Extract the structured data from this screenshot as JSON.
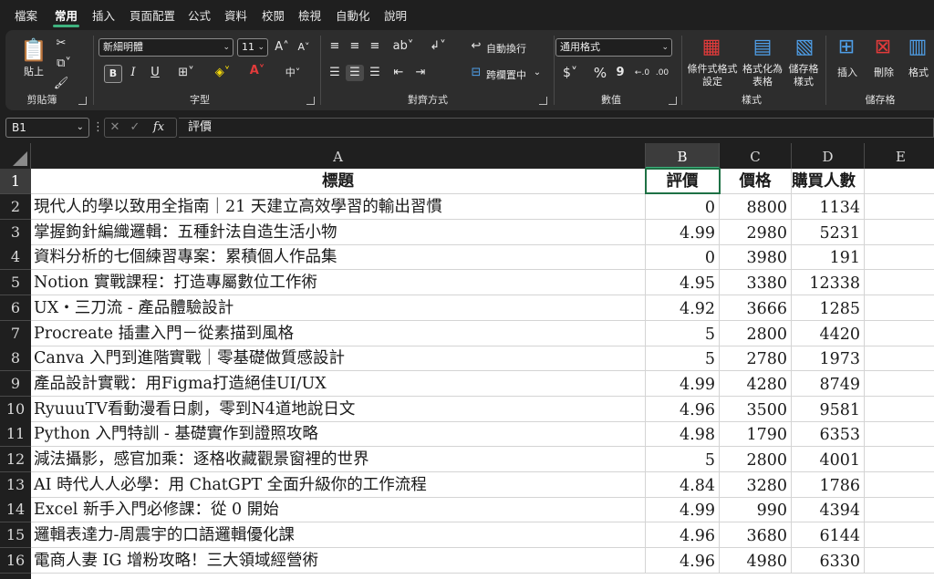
{
  "tabs": [
    "檔案",
    "常用",
    "插入",
    "頁面配置",
    "公式",
    "資料",
    "校閱",
    "檢視",
    "自動化",
    "說明"
  ],
  "ribbon": {
    "clipboard": {
      "paste": "貼上",
      "label": "剪貼簿"
    },
    "font": {
      "name": "新細明體",
      "size": "11",
      "label": "字型",
      "bold": "B",
      "italic": "I",
      "underline": "U"
    },
    "alignment": {
      "wrap": "自動換行",
      "merge": "跨欄置中",
      "label": "對齊方式"
    },
    "number": {
      "format": "通用格式",
      "currency": "$",
      "percent": "%",
      "comma": "9",
      "label": "數值"
    },
    "styles": {
      "conditional": "條件式格式\n設定",
      "table": "格式化為\n表格",
      "cell": "儲存格\n樣式",
      "label": "樣式"
    },
    "cells": {
      "insert": "插入",
      "delete": "刪除",
      "format": "格式",
      "label": "儲存格"
    }
  },
  "formula_bar": {
    "name_box": "B1",
    "fx": "fx",
    "content": "評價"
  },
  "columns": [
    "A",
    "B",
    "C",
    "D",
    "E"
  ],
  "headers": {
    "title": "標題",
    "rating": "評價",
    "price": "價格",
    "buyers": "購買人數"
  },
  "rows": [
    {
      "n": "2",
      "title": "現代人的學以致用全指南｜21 天建立高效學習的輸出習慣",
      "rating": "0",
      "price": "8800",
      "buyers": "1134"
    },
    {
      "n": "3",
      "title": "掌握鉤針編織邏輯：五種針法自造生活小物",
      "rating": "4.99",
      "price": "2980",
      "buyers": "5231"
    },
    {
      "n": "4",
      "title": "資料分析的七個練習專案：累積個人作品集",
      "rating": "0",
      "price": "3980",
      "buyers": "191"
    },
    {
      "n": "5",
      "title": "Notion 實戰課程：打造專屬數位工作術",
      "rating": "4.95",
      "price": "3380",
      "buyers": "12338"
    },
    {
      "n": "6",
      "title": "UX・三刀流 - 產品體驗設計",
      "rating": "4.92",
      "price": "3666",
      "buyers": "1285"
    },
    {
      "n": "7",
      "title": "Procreate 插畫入門－從素描到風格",
      "rating": "5",
      "price": "2800",
      "buyers": "4420"
    },
    {
      "n": "8",
      "title": "Canva 入門到進階實戰｜零基礎做質感設計",
      "rating": "5",
      "price": "2780",
      "buyers": "1973"
    },
    {
      "n": "9",
      "title": "產品設計實戰：用Figma打造絕佳UI/UX",
      "rating": "4.99",
      "price": "4280",
      "buyers": "8749"
    },
    {
      "n": "10",
      "title": "RyuuuTV看動漫看日劇，零到N4道地說日文",
      "rating": "4.96",
      "price": "3500",
      "buyers": "9581"
    },
    {
      "n": "11",
      "title": "Python 入門特訓 - 基礎實作到證照攻略",
      "rating": "4.98",
      "price": "1790",
      "buyers": "6353"
    },
    {
      "n": "12",
      "title": "減法攝影，感官加乘：逐格收藏觀景窗裡的世界",
      "rating": "5",
      "price": "2800",
      "buyers": "4001"
    },
    {
      "n": "13",
      "title": "AI 時代人人必學：用 ChatGPT 全面升級你的工作流程",
      "rating": "4.84",
      "price": "3280",
      "buyers": "1786"
    },
    {
      "n": "14",
      "title": "Excel 新手入門必修課：從 0 開始",
      "rating": "4.99",
      "price": "990",
      "buyers": "4394"
    },
    {
      "n": "15",
      "title": "邏輯表達力-周震宇的口語邏輯優化課",
      "rating": "4.96",
      "price": "3680",
      "buyers": "6144"
    },
    {
      "n": "16",
      "title": "電商人妻 IG 增粉攻略！三大領域經營術",
      "rating": "4.96",
      "price": "4980",
      "buyers": "6330"
    }
  ]
}
